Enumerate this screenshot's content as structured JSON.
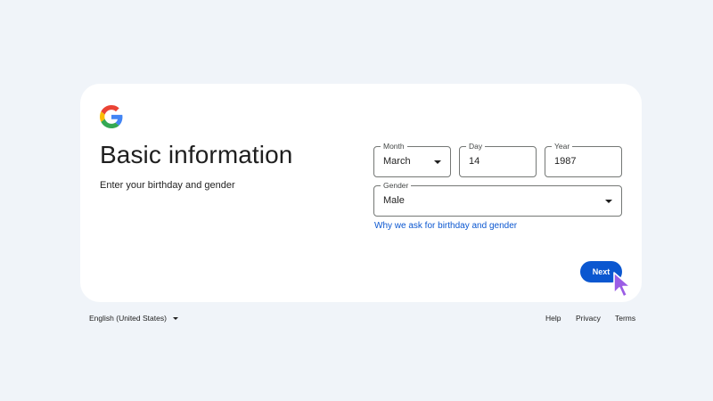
{
  "header": {
    "title": "Basic information",
    "subtitle": "Enter your birthday and gender"
  },
  "form": {
    "month": {
      "label": "Month",
      "value": "March"
    },
    "day": {
      "label": "Day",
      "value": "14"
    },
    "year": {
      "label": "Year",
      "value": "1987"
    },
    "gender": {
      "label": "Gender",
      "value": "Male"
    },
    "why_link": "Why we ask for birthday and gender",
    "next_label": "Next"
  },
  "footer": {
    "language": "English (United States)",
    "help": "Help",
    "privacy": "Privacy",
    "terms": "Terms"
  },
  "icons": {
    "logo": "google-g-logo",
    "dropdown": "caret-down-icon",
    "pointer": "cursor-arrow-icon"
  },
  "colors": {
    "background": "#f0f4f9",
    "card": "#ffffff",
    "accent": "#0b57d0",
    "cursor": "#9b5de5"
  }
}
